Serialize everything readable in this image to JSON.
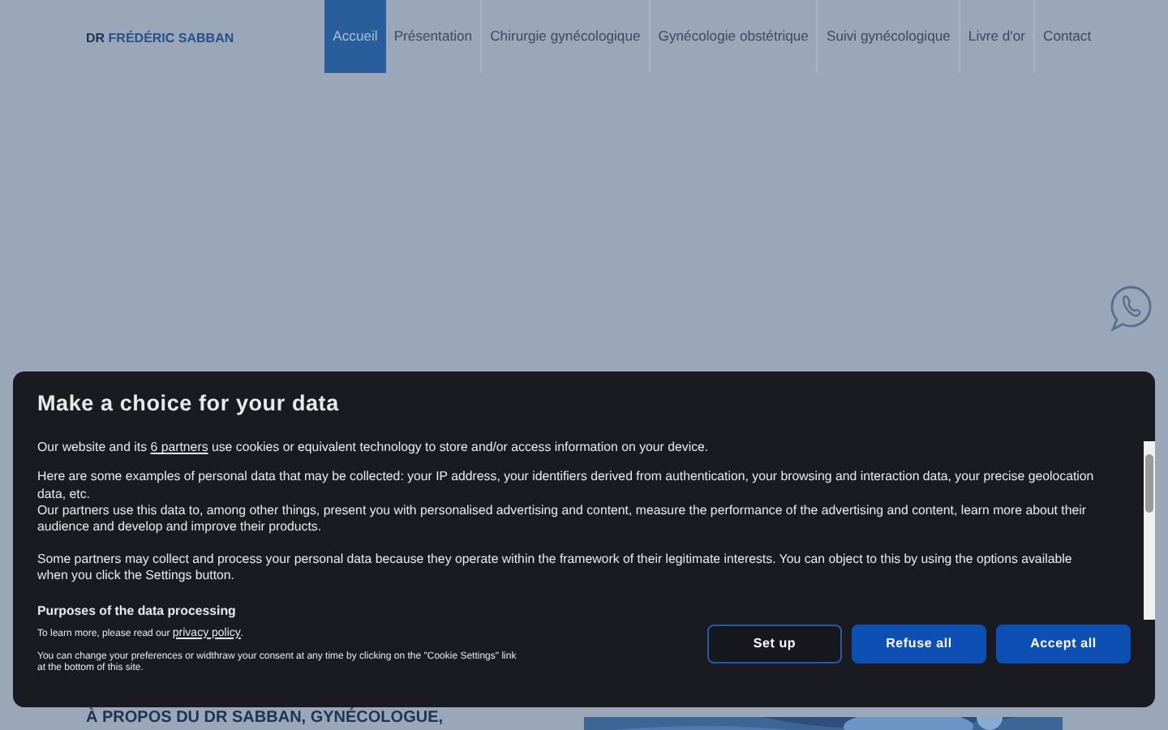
{
  "brand": {
    "prefix": "DR",
    "name": "FRÉDÉRIC SABBAN"
  },
  "nav": [
    {
      "label": "Accueil",
      "selected": true
    },
    {
      "label": "Présentation",
      "selected": false
    },
    {
      "label": "Chirurgie gynécologique",
      "selected": false
    },
    {
      "label": "Gynécologie obstétrique",
      "selected": false
    },
    {
      "label": "Suivi gynécologique",
      "selected": false
    },
    {
      "label": "Livre d'or",
      "selected": false
    },
    {
      "label": "Contact",
      "selected": false
    }
  ],
  "section": {
    "heading": "À PROPOS DU DR SABBAN, GYNÉCOLOGUE,"
  },
  "consent": {
    "title": "Make a choice for your data",
    "intro_before": "Our website and its ",
    "partners_link": "6 partners",
    "intro_after": " use cookies or equivalent technology to store and/or access information on your device.",
    "paragraphs": [
      "Here are some examples of personal data that may be collected: your IP address, your identifiers derived from authentication, your browsing and interaction data, your precise geolocation data, etc.",
      "Our partners use this data to, among other things, present you with personalised advertising and content, measure the performance of the advertising and content, learn more about their audience and develop and improve their products.",
      "Some partners may collect and process your personal data because they operate within the framework of their legitimate interests. You can object to this by using the options available when you click the Settings button."
    ],
    "purposes_heading": "Purposes of the data processing",
    "privacy_before": "To learn more, please read our ",
    "privacy_link": "privacy policy",
    "privacy_after": ".",
    "note": "You can change your preferences or widthraw your consent at any time by clicking on the \"Cookie Settings\" link at the bottom of this site.",
    "buttons": [
      {
        "label": "Set up",
        "kind": "outline"
      },
      {
        "label": "Refuse all",
        "kind": "solid"
      },
      {
        "label": "Accept all",
        "kind": "solid"
      }
    ]
  }
}
